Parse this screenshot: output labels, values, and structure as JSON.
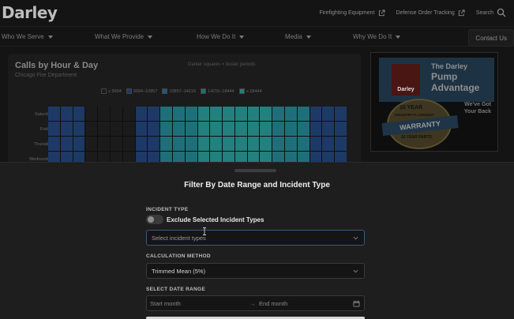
{
  "site": {
    "logo": "Darley",
    "top_links": [
      {
        "label": "Firefighting Equipment",
        "icon": "external-link-icon"
      },
      {
        "label": "Defense Order Tracking",
        "icon": "external-link-icon"
      },
      {
        "label": "Search",
        "icon": "search-icon"
      }
    ],
    "nav": [
      {
        "label": "Who We Serve"
      },
      {
        "label": "What We Provide"
      },
      {
        "label": "How We Do It"
      },
      {
        "label": "Media"
      },
      {
        "label": "Why We Do It"
      }
    ],
    "contact_label": "Contact Us"
  },
  "report": {
    "title": "Calls by Hour & Day",
    "subtitle": "Chicago Fire Department",
    "note": "Darker squares = busier periods",
    "legend": [
      "≤ 9694",
      "9694–10857",
      "10857–14215",
      "14215–18444",
      "≥ 18444"
    ],
    "legend_colors": [
      "#1b1b1b",
      "#1d3a66",
      "#1d5a7a",
      "#1f6f7a",
      "#23807e"
    ],
    "rows": [
      "Saturday",
      "Friday",
      "Thursday",
      "Wednesday"
    ]
  },
  "ad": {
    "logo": "Darley",
    "line1": "The Darley",
    "line2": "Pump",
    "line3": "Advantage",
    "badge_top": "10 YEAR",
    "badge_sub": "INDUSTRY'S LONGEST",
    "ribbon": "WARRANTY",
    "parts": "10 YEAR PARTS",
    "side1": "We've Got",
    "side2": "Your Back"
  },
  "filter": {
    "title": "Filter By Date Range and Incident Type",
    "incident_type_label": "INCIDENT TYPE",
    "exclude_label": "Exclude Selected Incident Types",
    "exclude_on": false,
    "incident_placeholder": "Select incident types",
    "calc_label": "CALCULATION METHOD",
    "calc_value": "Trimmed Mean (5%)",
    "date_label": "SELECT DATE RANGE",
    "start_placeholder": "Start month",
    "arrow": "→",
    "end_placeholder": "End month"
  }
}
